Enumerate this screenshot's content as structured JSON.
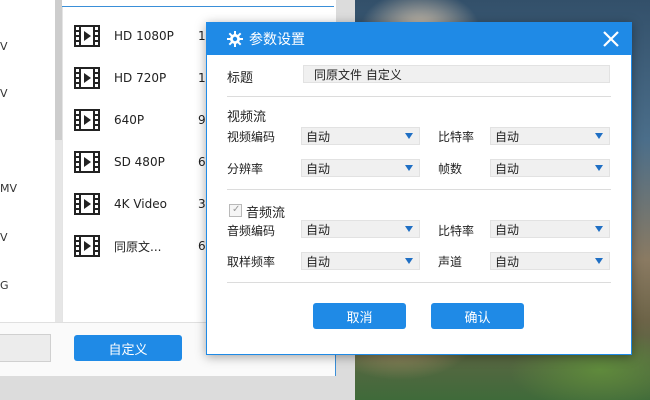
{
  "left_formats": [
    "V",
    "V",
    "MV",
    "V",
    "G"
  ],
  "presets": [
    {
      "label": "HD 1080P",
      "extra": "1"
    },
    {
      "label": "HD 720P",
      "extra": "1"
    },
    {
      "label": "640P",
      "extra": "9"
    },
    {
      "label": "SD 480P",
      "extra": "6"
    },
    {
      "label": "4K Video",
      "extra": "3"
    },
    {
      "label": "同原文...",
      "extra": "6"
    }
  ],
  "main": {
    "customize_label": "自定义"
  },
  "dialog": {
    "title": "参数设置",
    "title_label": "标题",
    "title_value": "同原文件 自定义",
    "video_section": "视频流",
    "video_codec_label": "视频编码",
    "video_codec_value": "自动",
    "video_bitrate_label": "比特率",
    "video_bitrate_value": "自动",
    "resolution_label": "分辨率",
    "resolution_value": "自动",
    "framerate_label": "帧数",
    "framerate_value": "自动",
    "audio_section": "音频流",
    "audio_checked": true,
    "audio_codec_label": "音频编码",
    "audio_codec_value": "自动",
    "audio_bitrate_label": "比特率",
    "audio_bitrate_value": "自动",
    "samplerate_label": "取样频率",
    "samplerate_value": "自动",
    "channel_label": "声道",
    "channel_value": "自动",
    "cancel_label": "取消",
    "ok_label": "确认"
  },
  "colors": {
    "accent": "#1f8ae6",
    "arrow": "#1f6fc4"
  },
  "icons": {
    "title": "gear-icon",
    "close": "close-icon",
    "preset": "film-icon",
    "dropdown": "dropdown-arrow-icon"
  }
}
